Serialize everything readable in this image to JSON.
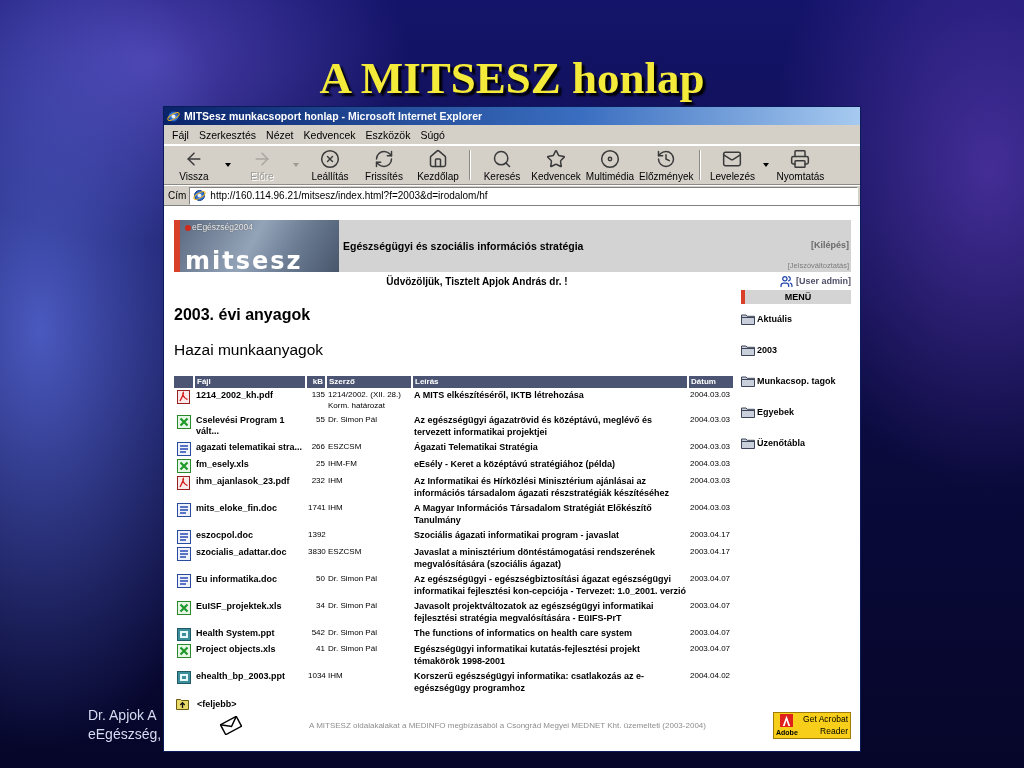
{
  "slide": {
    "title": "A MITSESZ honlap",
    "footer_lines": [
      "Dr. Apjok A",
      "eEgészség,"
    ]
  },
  "browser": {
    "title": "MITSesz munkacsoport honlap - Microsoft Internet Explorer",
    "menu": [
      "Fájl",
      "Szerkesztés",
      "Nézet",
      "Kedvencek",
      "Eszközök",
      "Súgó"
    ],
    "toolbar_groups": [
      [
        {
          "label": "Vissza",
          "disabled": false,
          "dropdown": true
        },
        {
          "label": "Előre",
          "disabled": true,
          "dropdown": true
        },
        {
          "label": "Leállítás",
          "disabled": false,
          "dropdown": false
        },
        {
          "label": "Frissítés",
          "disabled": false,
          "dropdown": false
        },
        {
          "label": "Kezdőlap",
          "disabled": false,
          "dropdown": false
        }
      ],
      [
        {
          "label": "Keresés",
          "disabled": false,
          "dropdown": false
        },
        {
          "label": "Kedvencek",
          "disabled": false,
          "dropdown": false
        },
        {
          "label": "Multimédia",
          "disabled": false,
          "dropdown": false
        },
        {
          "label": "Előzmények",
          "disabled": false,
          "dropdown": false
        }
      ],
      [
        {
          "label": "Levelezés",
          "disabled": false,
          "dropdown": true
        },
        {
          "label": "Nyomtatás",
          "disabled": false,
          "dropdown": false
        }
      ]
    ],
    "address": {
      "label": "Cím",
      "url": "http://160.114.96.21/mitsesz/index.html?f=2003&d=irodalom/hf"
    }
  },
  "page": {
    "banner": {
      "tag": "eEgészség2004",
      "logo": "mitsesz",
      "heading": "Egészségügyi és szociális információs stratégia",
      "logout": "[Kilépés]",
      "password_change": "[Jelszóváltoztatás]"
    },
    "welcome": "Üdvözöljük, Tisztelt Apjok András dr. !",
    "user": "[User admin]",
    "menu": {
      "title": "MENÜ",
      "items": [
        "Aktuális",
        "2003",
        "Munkacsop. tagok",
        "Egyebek",
        "Üzenőtábla"
      ]
    },
    "heading": "2003. évi anyagok",
    "subheading": "Hazai munkaanyagok",
    "table": {
      "columns": [
        "Fájl",
        "kB",
        "Szerző",
        "Leírás",
        "Dátum"
      ],
      "rows": [
        {
          "kind": "pdf",
          "file": "1214_2002_kh.pdf",
          "size": "135",
          "author": "1214/2002. (XII. 28.) Korm. határozat",
          "description": "A MITS elkészítéséről, IKTB létrehozása",
          "date": "2004.03.03"
        },
        {
          "kind": "xls",
          "file": "Cselevési Program 1 vált...",
          "size": "55",
          "author": "Dr. Simon Pál",
          "description": "Az egészségügyi ágazatrövid és középtávú, meglévő és tervezett informatikai projektjei",
          "date": "2004.03.03"
        },
        {
          "kind": "doc",
          "file": "agazati telematikai stra...",
          "size": "266",
          "author": "ESZCSM",
          "description": "Ágazati Telematikai Stratégia",
          "date": "2004.03.03"
        },
        {
          "kind": "xls",
          "file": "fm_esely.xls",
          "size": "25",
          "author": "IHM-FM",
          "description": "eEsély - Keret a középtávú stratégiához (példa)",
          "date": "2004.03.03"
        },
        {
          "kind": "pdf",
          "file": "ihm_ajanlasok_23.pdf",
          "size": "232",
          "author": "IHM",
          "description": "Az Informatikai és Hírközlési Minisztérium ajánlásai az információs társadalom ágazati részstratégiák készítéséhez",
          "date": "2004.03.03"
        },
        {
          "kind": "doc",
          "file": "mits_eloke_fin.doc",
          "size": "1741",
          "author": "IHM",
          "description": "A Magyar Információs Társadalom Stratégiát Előkészítő Tanulmány",
          "date": "2004.03.03"
        },
        {
          "kind": "doc",
          "file": "eszocpol.doc",
          "size": "1392",
          "description": "Szociális ágazati informatikai program - javaslat",
          "date": "2003.04.17"
        },
        {
          "kind": "doc",
          "file": "szocialis_adattar.doc",
          "size": "3830",
          "author": "ESZCSM",
          "description": "Javaslat a minisztérium döntéstámogatási rendszerének megvalósítására (szociális ágazat)",
          "date": "2003.04.17"
        },
        {
          "kind": "doc",
          "file": "Eu informatika.doc",
          "size": "50",
          "author": "Dr. Simon Pál",
          "description": "Az egészségügyi - egészségbiztosítási ágazat egészségügyi informatikai fejlesztési kon-cepciója - Tervezet: 1.0_2001. verzió",
          "date": "2003.04.07"
        },
        {
          "kind": "xls",
          "file": "EuISF_projektek.xls",
          "size": "34",
          "author": "Dr. Simon Pál",
          "description": "Javasolt projektváltozatok az egészségügyi informatikai fejlesztési stratégia megvalósítására - EüIFS-PrT",
          "date": "2003.04.07"
        },
        {
          "kind": "ppt",
          "file": "Health System.ppt",
          "size": "542",
          "author": "Dr. Simon Pál",
          "description": "The functions of informatics on health care system",
          "date": "2003.04.07"
        },
        {
          "kind": "xls",
          "file": "Project objects.xls",
          "size": "41",
          "author": "Dr. Simon Pál",
          "description": "Egészségügyi informatikai kutatás-fejlesztési projekt témakörök 1998-2001",
          "date": "2003.04.07"
        },
        {
          "kind": "ppt",
          "file": "ehealth_bp_2003.ppt",
          "size": "1034",
          "author": "IHM",
          "description": "Korszerű egészségügyi informatika: csatlakozás az e-egészségügy programhoz",
          "date": "2004.04.02"
        }
      ]
    },
    "up_link": "<feljebb>",
    "footer": "A MITSESZ oldalakalakat a MEDINFO megbízásából a Csongrád Megyei MEDNET Kht. üzemelteti (2003-2004)",
    "reader_badge": {
      "brand": "Adobe",
      "lines": [
        "Get Acrobat",
        "Reader"
      ]
    }
  }
}
